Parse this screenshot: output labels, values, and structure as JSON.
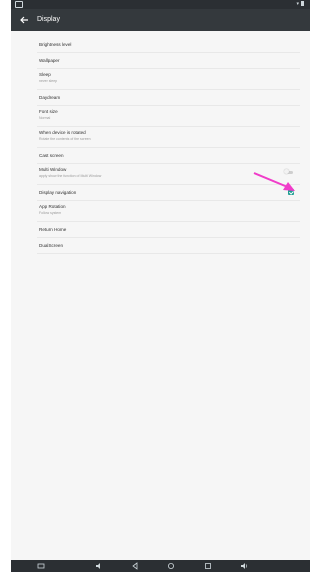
{
  "toolbar": {
    "title": "Display"
  },
  "settings": [
    {
      "label": "Brightness level",
      "summary": ""
    },
    {
      "label": "Wallpaper",
      "summary": ""
    },
    {
      "label": "Sleep",
      "summary": "never sleep"
    },
    {
      "label": "Daydream",
      "summary": ""
    },
    {
      "label": "Font size",
      "summary": "Normal"
    },
    {
      "label": "When device is rotated",
      "summary": "Rotate the contents of the screen"
    },
    {
      "label": "Cast screen",
      "summary": ""
    },
    {
      "label": "Multi Window",
      "summary": "apply show the function of Multi Window",
      "toggle_on": false
    },
    {
      "label": "Display navigation",
      "summary": "",
      "checked": true
    },
    {
      "label": "App Rotation",
      "summary": "Follow system"
    },
    {
      "label": "Return Home",
      "summary": ""
    },
    {
      "label": "DualScreen",
      "summary": ""
    }
  ],
  "colors": {
    "toolbar": "#34393d",
    "statusbar": "#2b2f33",
    "accent": "#1f9e92",
    "annotation_arrow": "#f03cc9"
  },
  "icons": {
    "back": "arrow-left-icon",
    "navbar": [
      "screenshot-icon",
      "volume-down-icon",
      "back-icon",
      "home-icon",
      "recents-icon",
      "volume-up-icon"
    ]
  }
}
